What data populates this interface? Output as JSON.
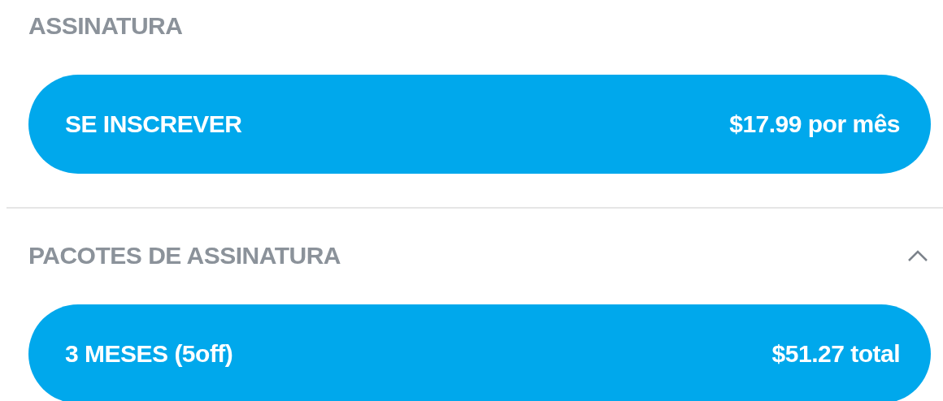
{
  "subscription": {
    "heading": "ASSINATURA",
    "button": {
      "label": "SE INSCREVER",
      "price": "$17.99 por mês"
    }
  },
  "packages": {
    "heading": "PACOTES DE ASSINATURA",
    "expanded": true,
    "items": [
      {
        "label": "3 MESES (5off)",
        "price": "$51.27 total"
      }
    ]
  }
}
